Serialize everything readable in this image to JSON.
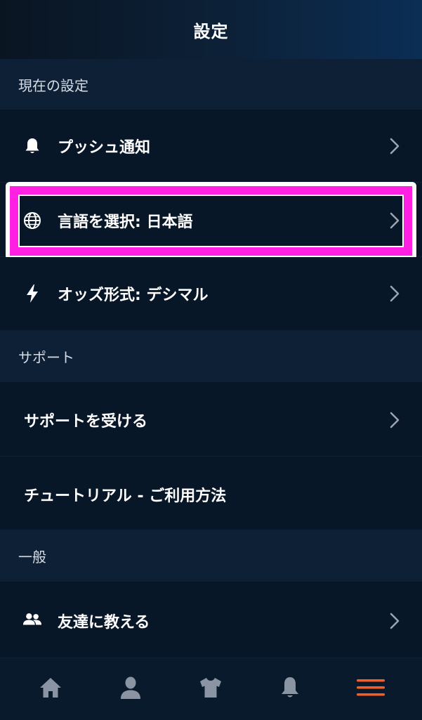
{
  "header": {
    "title": "設定"
  },
  "sections": {
    "current": {
      "title": "現在の設定"
    },
    "support": {
      "title": "サポート"
    },
    "general": {
      "title": "一般"
    }
  },
  "rows": {
    "push": {
      "label": "プッシュ通知",
      "icon": "bell-icon"
    },
    "language": {
      "label": "言語を選択: 日本語",
      "icon": "globe-icon"
    },
    "odds": {
      "label": "オッズ形式: デシマル",
      "icon": "lightning-bolt-icon"
    },
    "get_support": {
      "label": "サポートを受ける"
    },
    "tutorial": {
      "label": "チュートリアル - ご利用方法"
    },
    "invite": {
      "label": "友達に教える",
      "icon": "people-icon"
    }
  },
  "tabs": [
    {
      "icon": "home-icon",
      "active": false
    },
    {
      "icon": "person-icon",
      "active": false
    },
    {
      "icon": "shirt-icon",
      "active": false
    },
    {
      "icon": "bell-icon",
      "active": false
    },
    {
      "icon": "hamburger-menu-icon",
      "active": true
    }
  ],
  "colors": {
    "background": "#0a1a2d",
    "row_background": "#081728",
    "section_background": "#0e2035",
    "highlight": "#ff20e2",
    "active_tab": "#ff5a1f",
    "inactive_tab": "#8a94a3",
    "chevron": "#9aa4b2"
  }
}
